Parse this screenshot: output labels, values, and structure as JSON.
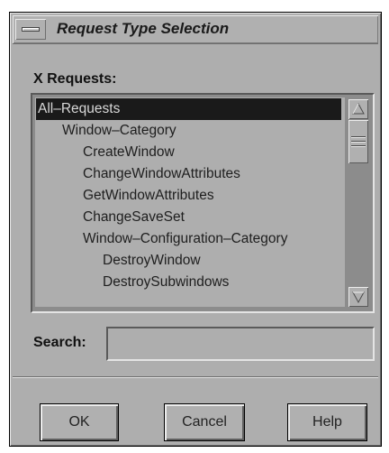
{
  "window": {
    "title": "Request Type Selection"
  },
  "requests": {
    "label": "X Requests:",
    "items": [
      {
        "label": "All–Requests",
        "indent": 0,
        "selected": true
      },
      {
        "label": "Window–Category",
        "indent": 1,
        "selected": false
      },
      {
        "label": "CreateWindow",
        "indent": 2,
        "selected": false
      },
      {
        "label": "ChangeWindowAttributes",
        "indent": 2,
        "selected": false
      },
      {
        "label": "GetWindowAttributes",
        "indent": 2,
        "selected": false
      },
      {
        "label": "ChangeSaveSet",
        "indent": 2,
        "selected": false
      },
      {
        "label": "Window–Configuration–Category",
        "indent": 2,
        "selected": false
      },
      {
        "label": "DestroyWindow",
        "indent": 3,
        "selected": false
      },
      {
        "label": "DestroySubwindows",
        "indent": 3,
        "selected": false
      }
    ]
  },
  "search": {
    "label": "Search:",
    "value": "",
    "placeholder": ""
  },
  "buttons": {
    "ok": "OK",
    "cancel": "Cancel",
    "help": "Help"
  },
  "icons": {
    "window_menu": "window-menu-icon",
    "scroll_up": "triangle-up-icon",
    "scroll_down": "triangle-down-icon"
  },
  "colors": {
    "background": "#aeaeae",
    "selection": "#1a1a1a",
    "selection_text": "#d8d8d8",
    "text": "#1e1e1e"
  }
}
